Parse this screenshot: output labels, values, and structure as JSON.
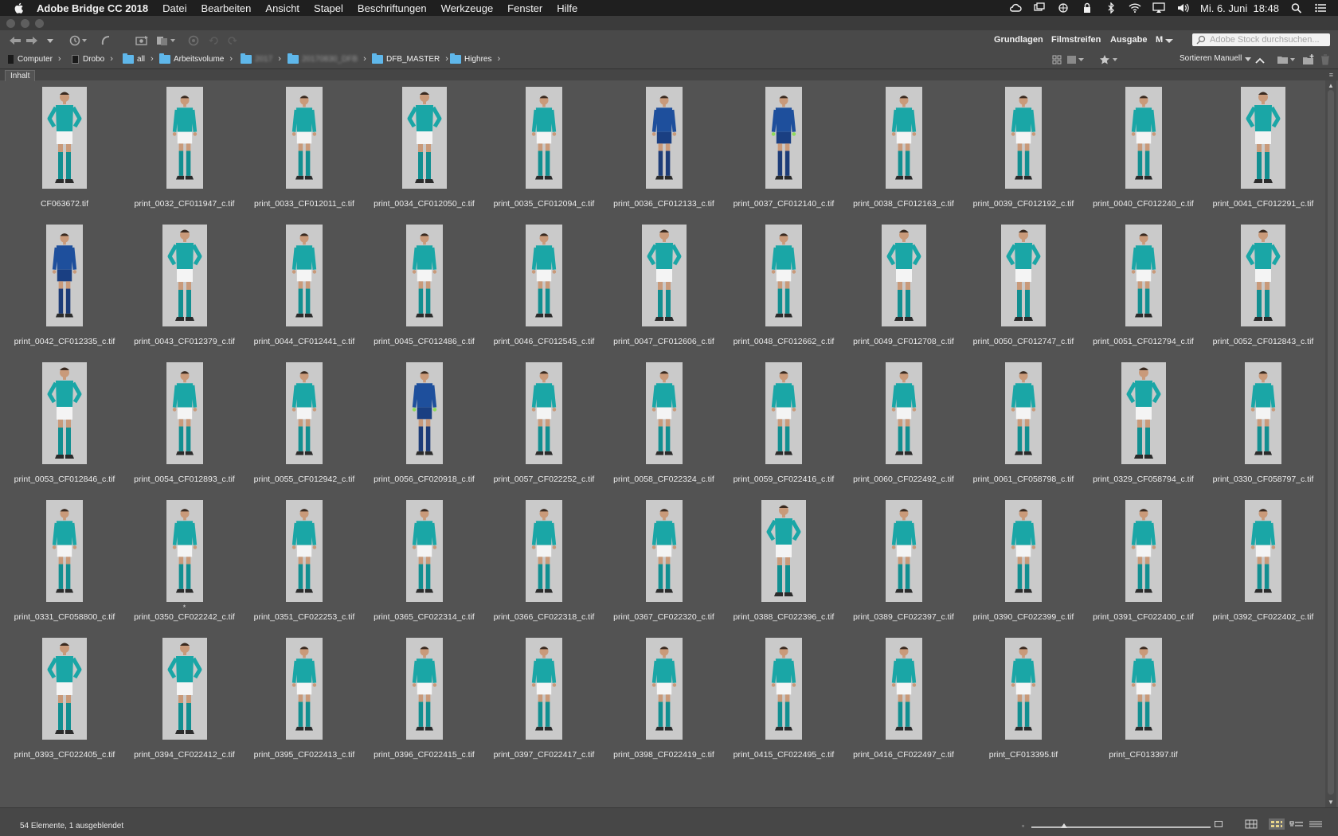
{
  "menubar": {
    "app_name": "Adobe Bridge CC 2018",
    "items": [
      "Datei",
      "Bearbeiten",
      "Ansicht",
      "Stapel",
      "Beschriftungen",
      "Werkzeuge",
      "Fenster",
      "Hilfe"
    ],
    "clock": "Mi. 6. Juni  18:48"
  },
  "toolbar": {
    "workspaces": [
      "Grundlagen",
      "Filmstreifen",
      "Ausgabe"
    ],
    "workspace_more": "M",
    "stock_search_placeholder": "Adobe Stock durchsuchen..."
  },
  "pathbar": {
    "crumbs": [
      {
        "label": "Computer",
        "icon": "hard-drive-icon"
      },
      {
        "label": "Drobo",
        "icon": "drobo-drive-icon"
      },
      {
        "label": "all",
        "icon": "folder-icon"
      },
      {
        "label": "Arbeitsvolume",
        "icon": "folder-icon"
      },
      {
        "label": "2017",
        "icon": "folder-icon",
        "obscured": true
      },
      {
        "label": "20170830_DFB",
        "icon": "folder-icon",
        "obscured": true
      },
      {
        "label": "DFB_MASTER",
        "icon": "folder-icon"
      },
      {
        "label": "Highres",
        "icon": "folder-icon"
      }
    ],
    "sort_label": "Sortieren Manuell"
  },
  "panel": {
    "tab_label": "Inhalt"
  },
  "thumbnails": [
    {
      "name": "CF063672.tif",
      "kit": "green",
      "pose": "hands_hips"
    },
    {
      "name": "print_0032_CF011947_c.tif",
      "kit": "green",
      "pose": "arms_down"
    },
    {
      "name": "print_0033_CF012011_c.tif",
      "kit": "green",
      "pose": "arms_down"
    },
    {
      "name": "print_0034_CF012050_c.tif",
      "kit": "green",
      "pose": "hands_hips"
    },
    {
      "name": "print_0035_CF012094_c.tif",
      "kit": "green",
      "pose": "arms_down"
    },
    {
      "name": "print_0036_CF012133_c.tif",
      "kit": "blue",
      "pose": "arms_down"
    },
    {
      "name": "print_0037_CF012140_c.tif",
      "kit": "blue",
      "pose": "gloves"
    },
    {
      "name": "print_0038_CF012163_c.tif",
      "kit": "green",
      "pose": "arms_down"
    },
    {
      "name": "print_0039_CF012192_c.tif",
      "kit": "green",
      "pose": "arms_down"
    },
    {
      "name": "print_0040_CF012240_c.tif",
      "kit": "green",
      "pose": "arms_down"
    },
    {
      "name": "print_0041_CF012291_c.tif",
      "kit": "green",
      "pose": "hands_hips"
    },
    {
      "name": "print_0042_CF012335_c.tif",
      "kit": "blue",
      "pose": "arms_down"
    },
    {
      "name": "print_0043_CF012379_c.tif",
      "kit": "green",
      "pose": "hands_hips"
    },
    {
      "name": "print_0044_CF012441_c.tif",
      "kit": "green",
      "pose": "arms_down"
    },
    {
      "name": "print_0045_CF012486_c.tif",
      "kit": "green",
      "pose": "arms_down"
    },
    {
      "name": "print_0046_CF012545_c.tif",
      "kit": "green",
      "pose": "arms_down"
    },
    {
      "name": "print_0047_CF012606_c.tif",
      "kit": "green",
      "pose": "hands_hips"
    },
    {
      "name": "print_0048_CF012662_c.tif",
      "kit": "green",
      "pose": "arms_down"
    },
    {
      "name": "print_0049_CF012708_c.tif",
      "kit": "green",
      "pose": "hands_hips"
    },
    {
      "name": "print_0050_CF012747_c.tif",
      "kit": "green",
      "pose": "hands_hips"
    },
    {
      "name": "print_0051_CF012794_c.tif",
      "kit": "green",
      "pose": "arms_down"
    },
    {
      "name": "print_0052_CF012843_c.tif",
      "kit": "green",
      "pose": "hands_hips"
    },
    {
      "name": "print_0053_CF012846_c.tif",
      "kit": "green",
      "pose": "hands_hips"
    },
    {
      "name": "print_0054_CF012893_c.tif",
      "kit": "green",
      "pose": "arms_down"
    },
    {
      "name": "print_0055_CF012942_c.tif",
      "kit": "green",
      "pose": "arms_down"
    },
    {
      "name": "print_0056_CF020918_c.tif",
      "kit": "blue",
      "pose": "gloves"
    },
    {
      "name": "print_0057_CF022252_c.tif",
      "kit": "green",
      "pose": "arms_down"
    },
    {
      "name": "print_0058_CF022324_c.tif",
      "kit": "green",
      "pose": "arms_down"
    },
    {
      "name": "print_0059_CF022416_c.tif",
      "kit": "green",
      "pose": "arms_down"
    },
    {
      "name": "print_0060_CF022492_c.tif",
      "kit": "green",
      "pose": "arms_down"
    },
    {
      "name": "print_0061_CF058798_c.tif",
      "kit": "green",
      "pose": "arms_down"
    },
    {
      "name": "print_0329_CF058794_c.tif",
      "kit": "green",
      "pose": "hands_hips"
    },
    {
      "name": "print_0330_CF058797_c.tif",
      "kit": "green",
      "pose": "arms_down"
    },
    {
      "name": "print_0331_CF058800_c.tif",
      "kit": "green",
      "pose": "arms_down"
    },
    {
      "name": "print_0350_CF022242_c.tif",
      "kit": "green",
      "pose": "arms_down",
      "marked": "*"
    },
    {
      "name": "print_0351_CF022253_c.tif",
      "kit": "green",
      "pose": "arms_down"
    },
    {
      "name": "print_0365_CF022314_c.tif",
      "kit": "green",
      "pose": "arms_down"
    },
    {
      "name": "print_0366_CF022318_c.tif",
      "kit": "green",
      "pose": "arms_down"
    },
    {
      "name": "print_0367_CF022320_c.tif",
      "kit": "green",
      "pose": "arms_down"
    },
    {
      "name": "print_0388_CF022396_c.tif",
      "kit": "green",
      "pose": "hands_hips"
    },
    {
      "name": "print_0389_CF022397_c.tif",
      "kit": "green",
      "pose": "arms_down"
    },
    {
      "name": "print_0390_CF022399_c.tif",
      "kit": "green",
      "pose": "arms_down"
    },
    {
      "name": "print_0391_CF022400_c.tif",
      "kit": "green",
      "pose": "arms_down"
    },
    {
      "name": "print_0392_CF022402_c.tif",
      "kit": "green",
      "pose": "arms_down"
    },
    {
      "name": "print_0393_CF022405_c.tif",
      "kit": "green",
      "pose": "hands_hips"
    },
    {
      "name": "print_0394_CF022412_c.tif",
      "kit": "green",
      "pose": "hands_hips"
    },
    {
      "name": "print_0395_CF022413_c.tif",
      "kit": "green",
      "pose": "arms_down"
    },
    {
      "name": "print_0396_CF022415_c.tif",
      "kit": "green",
      "pose": "arms_down"
    },
    {
      "name": "print_0397_CF022417_c.tif",
      "kit": "green",
      "pose": "arms_down"
    },
    {
      "name": "print_0398_CF022419_c.tif",
      "kit": "green",
      "pose": "arms_down"
    },
    {
      "name": "print_0415_CF022495_c.tif",
      "kit": "green",
      "pose": "arms_down"
    },
    {
      "name": "print_0416_CF022497_c.tif",
      "kit": "green",
      "pose": "arms_down"
    },
    {
      "name": "print_CF013395.tif",
      "kit": "green",
      "pose": "arms_down"
    },
    {
      "name": "print_CF013397.tif",
      "kit": "green",
      "pose": "arms_down"
    }
  ],
  "status": {
    "text": "54 Elemente, 1 ausgeblendet",
    "thumbnail_size_fraction": 0.18
  },
  "colors": {
    "content_bg": "#535353",
    "thumb_bg": "#cacaca",
    "green_kit": "#1aa6a6",
    "blue_kit": "#1e4f9c",
    "folder": "#5fb7ea"
  }
}
